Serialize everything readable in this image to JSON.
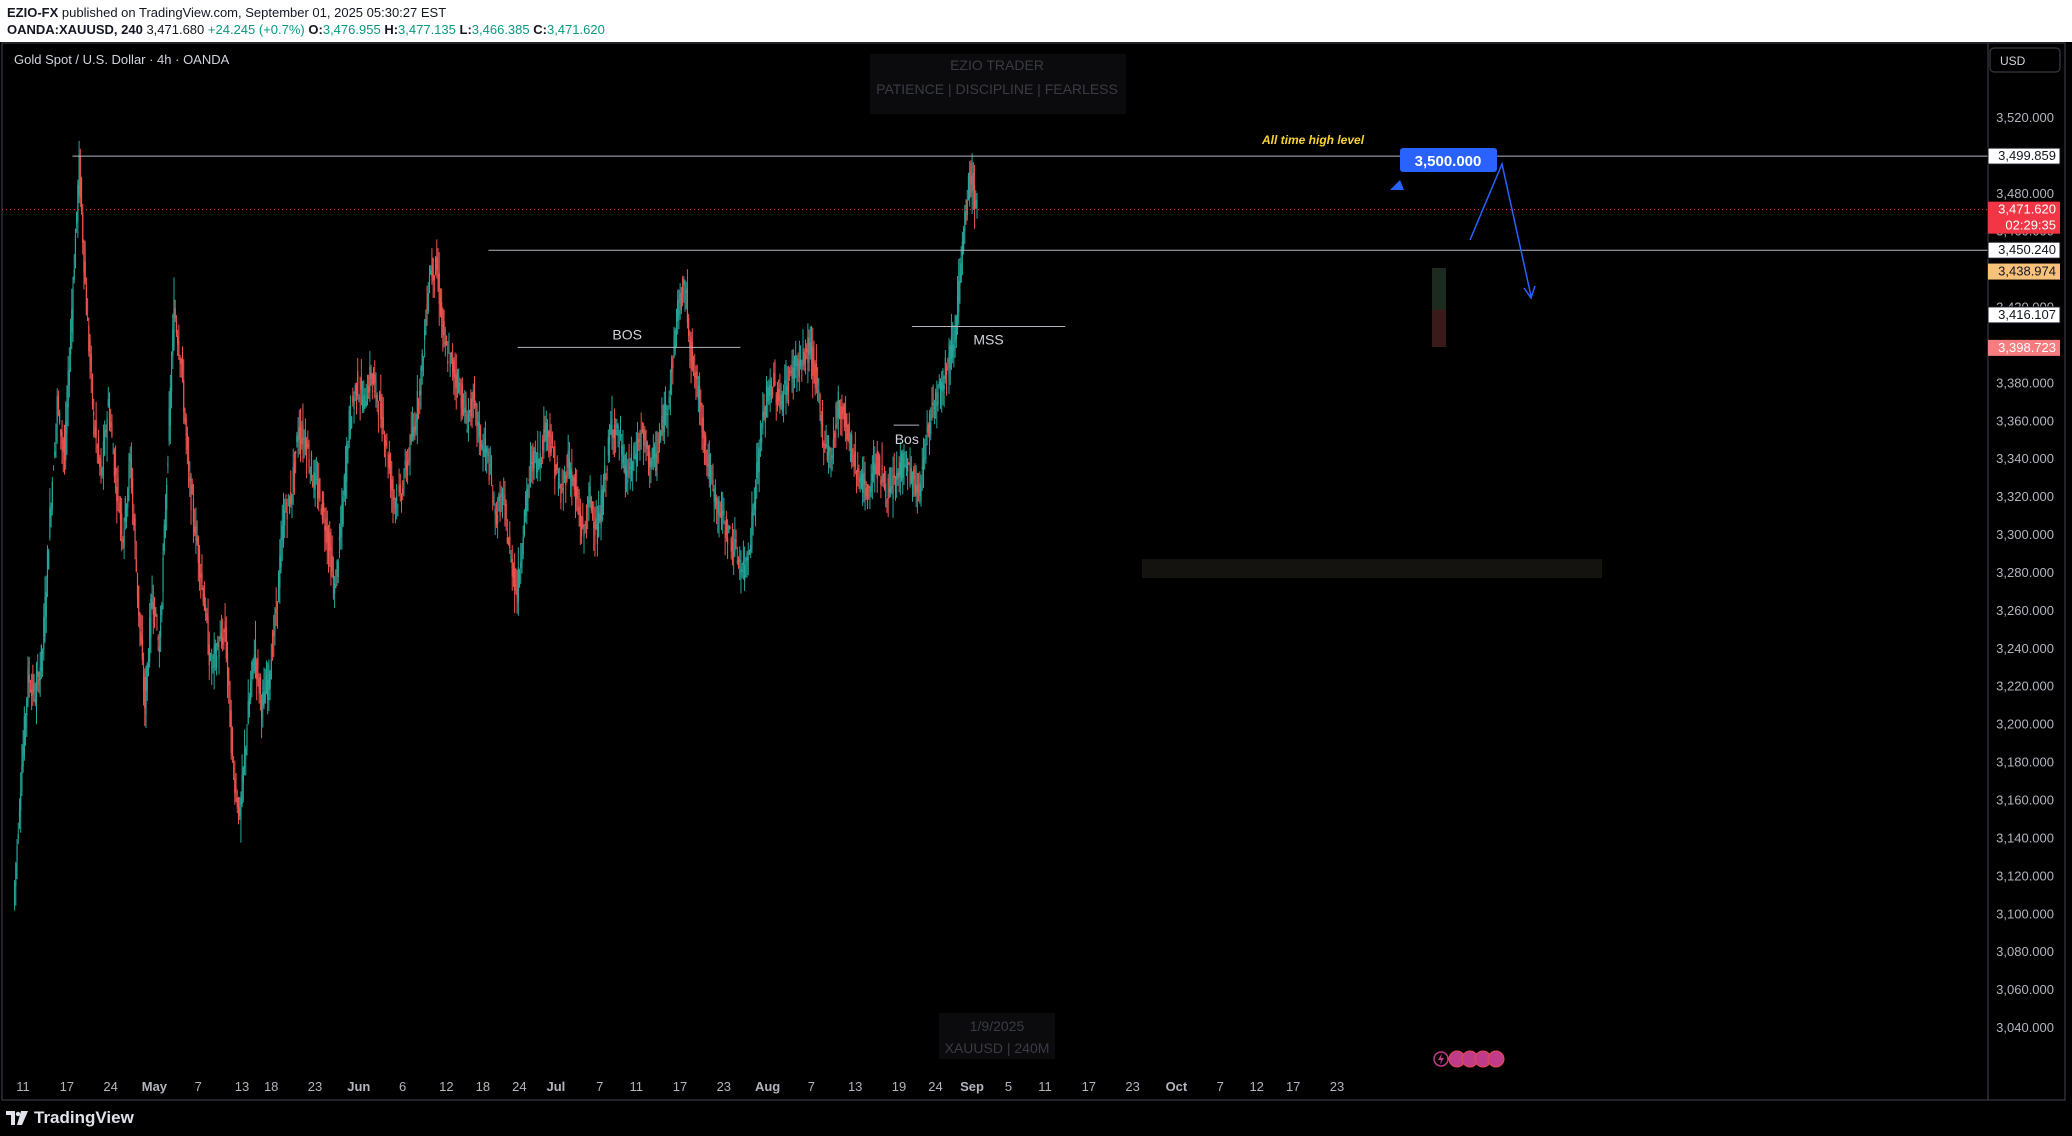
{
  "header": {
    "publisher": "EZIO-FX",
    "published_text": "published on TradingView.com, September 01, 2025 05:30:27 EST",
    "symbol": "OANDA:XAUUSD, 240",
    "last": "3,471.680",
    "change": "+24.245 (+0.7%)",
    "o_label": "O:",
    "o_value": "3,476.955",
    "h_label": "H:",
    "h_value": "3,477.135",
    "l_label": "L:",
    "l_value": "3,466.385",
    "c_label": "C:",
    "c_value": "3,471.620"
  },
  "chart_header": {
    "title": "Gold Spot / U.S. Dollar · 4h · OANDA",
    "currency_button": "USD"
  },
  "watermark": {
    "line1": "EZIO TRADER",
    "line2": "PATIENCE  |  DISCIPLINE  |  FEARLESS",
    "bottom_line1": "1/9/2025",
    "bottom_line2": "XAUUSD | 240M"
  },
  "footer": {
    "logo_text": "TradingView"
  },
  "colors": {
    "background": "#000000",
    "up": "#26a69a",
    "down": "#ef5350",
    "grid_text": "#b2b5be",
    "price_line": "#f23645",
    "callout": "#2962ff",
    "annotation_yellow": "#f7d434"
  },
  "chart_data": {
    "type": "candlestick",
    "title": "Gold Spot / U.S. Dollar · 4h · OANDA",
    "ylim": [
      3030,
      3540
    ],
    "y_ticks": [
      3040,
      3060,
      3080,
      3100,
      3120,
      3140,
      3160,
      3180,
      3200,
      3220,
      3240,
      3260,
      3280,
      3300,
      3320,
      3340,
      3360,
      3380,
      3400,
      3420,
      3440,
      3460,
      3480,
      3500,
      3520
    ],
    "y_tick_labels": [
      "3,040.000",
      "3,060.000",
      "3,080.000",
      "3,100.000",
      "3,120.000",
      "3,140.000",
      "3,160.000",
      "3,180.000",
      "3,200.000",
      "3,220.000",
      "3,240.000",
      "3,260.000",
      "3,280.000",
      "3,300.000",
      "3,320.000",
      "3,340.000",
      "3,360.000",
      "3,380.000",
      "3,400.000",
      "3,420.000",
      "3,440.000",
      "3,460.000",
      "3,480.000",
      "3,500.000",
      "3,520.000"
    ],
    "x_labels": [
      "11",
      "17",
      "24",
      "May",
      "7",
      "13",
      "18",
      "23",
      "Jun",
      "6",
      "12",
      "18",
      "24",
      "Jul",
      "7",
      "11",
      "17",
      "23",
      "Aug",
      "7",
      "13",
      "19",
      "24",
      "Sep",
      "5",
      "11",
      "17",
      "23",
      "Oct",
      "7",
      "12",
      "17",
      "23"
    ],
    "x_label_index": [
      0,
      6,
      12,
      18,
      24,
      30,
      34,
      40,
      46,
      52,
      58,
      63,
      68,
      73,
      79,
      84,
      90,
      96,
      102,
      108,
      114,
      120,
      125,
      130,
      135,
      140,
      146,
      152,
      158,
      164,
      169,
      174,
      180
    ],
    "price_path": [
      [
        0,
        3105
      ],
      [
        1,
        3170
      ],
      [
        2,
        3225
      ],
      [
        3,
        3215
      ],
      [
        4,
        3240
      ],
      [
        5,
        3310
      ],
      [
        6,
        3370
      ],
      [
        7,
        3340
      ],
      [
        8,
        3420
      ],
      [
        9,
        3495
      ],
      [
        10,
        3420
      ],
      [
        11,
        3360
      ],
      [
        12,
        3330
      ],
      [
        13,
        3370
      ],
      [
        14,
        3330
      ],
      [
        15,
        3300
      ],
      [
        16,
        3340
      ],
      [
        17,
        3270
      ],
      [
        18,
        3210
      ],
      [
        19,
        3270
      ],
      [
        20,
        3240
      ],
      [
        21,
        3330
      ],
      [
        22,
        3420
      ],
      [
        23,
        3390
      ],
      [
        24,
        3330
      ],
      [
        25,
        3300
      ],
      [
        26,
        3270
      ],
      [
        27,
        3230
      ],
      [
        28,
        3240
      ],
      [
        29,
        3250
      ],
      [
        30,
        3180
      ],
      [
        31,
        3150
      ],
      [
        32,
        3200
      ],
      [
        33,
        3240
      ],
      [
        34,
        3210
      ],
      [
        35,
        3225
      ],
      [
        36,
        3260
      ],
      [
        37,
        3310
      ],
      [
        38,
        3320
      ],
      [
        39,
        3355
      ],
      [
        40,
        3350
      ],
      [
        41,
        3330
      ],
      [
        42,
        3320
      ],
      [
        43,
        3300
      ],
      [
        44,
        3270
      ],
      [
        45,
        3310
      ],
      [
        46,
        3360
      ],
      [
        47,
        3380
      ],
      [
        48,
        3370
      ],
      [
        49,
        3385
      ],
      [
        50,
        3370
      ],
      [
        51,
        3350
      ],
      [
        52,
        3320
      ],
      [
        53,
        3320
      ],
      [
        54,
        3340
      ],
      [
        55,
        3360
      ],
      [
        56,
        3390
      ],
      [
        57,
        3440
      ],
      [
        58,
        3440
      ],
      [
        59,
        3400
      ],
      [
        60,
        3390
      ],
      [
        61,
        3380
      ],
      [
        62,
        3360
      ],
      [
        63,
        3370
      ],
      [
        64,
        3350
      ],
      [
        65,
        3340
      ],
      [
        66,
        3310
      ],
      [
        67,
        3320
      ],
      [
        68,
        3290
      ],
      [
        69,
        3270
      ],
      [
        70,
        3310
      ],
      [
        71,
        3340
      ],
      [
        72,
        3340
      ],
      [
        73,
        3360
      ],
      [
        74,
        3340
      ],
      [
        75,
        3320
      ],
      [
        76,
        3340
      ],
      [
        77,
        3320
      ],
      [
        78,
        3300
      ],
      [
        79,
        3320
      ],
      [
        80,
        3300
      ],
      [
        81,
        3330
      ],
      [
        82,
        3360
      ],
      [
        83,
        3350
      ],
      [
        84,
        3330
      ],
      [
        85,
        3340
      ],
      [
        86,
        3355
      ],
      [
        87,
        3340
      ],
      [
        88,
        3340
      ],
      [
        89,
        3360
      ],
      [
        90,
        3380
      ],
      [
        91,
        3420
      ],
      [
        92,
        3430
      ],
      [
        93,
        3390
      ],
      [
        94,
        3370
      ],
      [
        95,
        3340
      ],
      [
        96,
        3320
      ],
      [
        97,
        3310
      ],
      [
        98,
        3300
      ],
      [
        99,
        3290
      ],
      [
        100,
        3280
      ],
      [
        101,
        3300
      ],
      [
        102,
        3340
      ],
      [
        103,
        3370
      ],
      [
        104,
        3380
      ],
      [
        105,
        3370
      ],
      [
        106,
        3380
      ],
      [
        107,
        3390
      ],
      [
        108,
        3390
      ],
      [
        109,
        3400
      ],
      [
        110,
        3380
      ],
      [
        111,
        3350
      ],
      [
        112,
        3340
      ],
      [
        113,
        3370
      ],
      [
        114,
        3360
      ],
      [
        115,
        3340
      ],
      [
        116,
        3330
      ],
      [
        117,
        3320
      ],
      [
        118,
        3340
      ],
      [
        119,
        3330
      ],
      [
        120,
        3320
      ],
      [
        121,
        3330
      ],
      [
        122,
        3340
      ],
      [
        123,
        3330
      ],
      [
        124,
        3320
      ],
      [
        125,
        3350
      ],
      [
        126,
        3370
      ],
      [
        127,
        3380
      ],
      [
        128,
        3390
      ],
      [
        129,
        3410
      ],
      [
        130,
        3450
      ],
      [
        131,
        3490
      ],
      [
        132,
        3472
      ]
    ],
    "price_levels": [
      {
        "value": 3499.859,
        "label": "3,499.859",
        "style": "white"
      },
      {
        "value": 3471.62,
        "label": "3,471.620",
        "sublabel": "02:29:35",
        "style": "red"
      },
      {
        "value": 3450.24,
        "label": "3,450.240",
        "style": "white"
      },
      {
        "value": 3438.974,
        "label": "3,438.974",
        "style": "orange"
      },
      {
        "value": 3416.107,
        "label": "3,416.107",
        "style": "white"
      },
      {
        "value": 3398.723,
        "label": "3,398.723",
        "style": "pink"
      }
    ],
    "annotations": [
      {
        "text": "BOS",
        "value": 3399
      },
      {
        "text": "MSS",
        "value": 3410
      },
      {
        "text": "Bos",
        "value": 3358
      },
      {
        "text": "All time high level",
        "value": 3500
      },
      {
        "text": "3,500.000",
        "value": 3500
      }
    ],
    "grid": false,
    "legend": "none"
  }
}
